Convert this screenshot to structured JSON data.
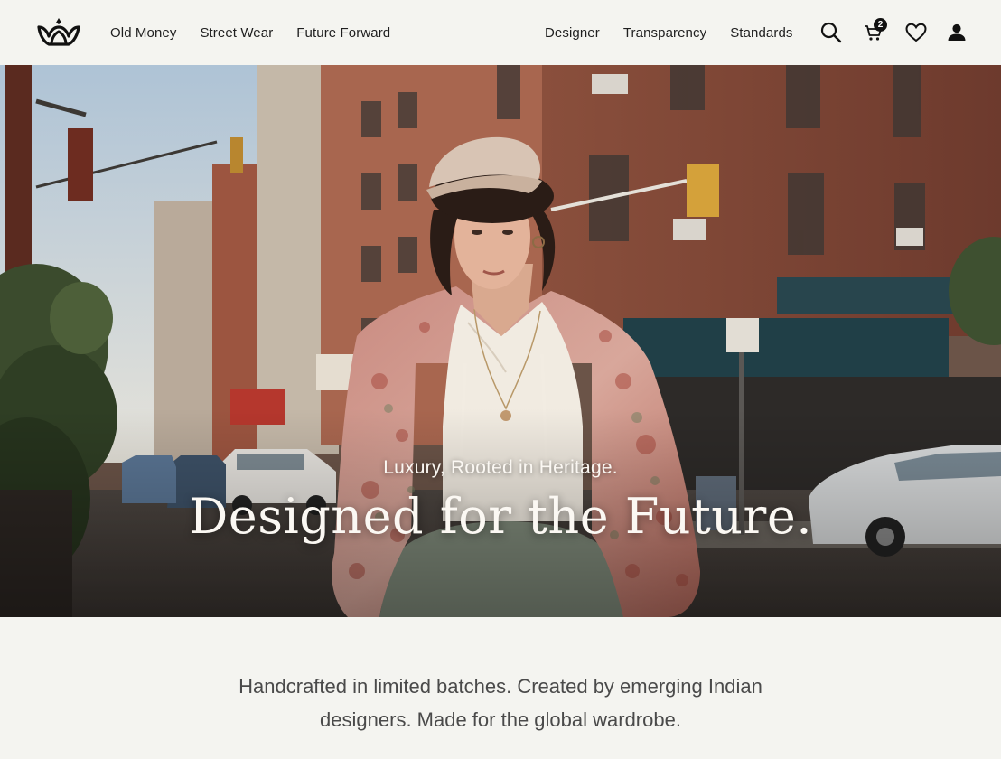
{
  "brand": {
    "logo_icon": "crown-lotus-icon"
  },
  "nav": {
    "left": [
      {
        "label": "Old Money"
      },
      {
        "label": "Street Wear"
      },
      {
        "label": "Future Forward"
      }
    ],
    "right": [
      {
        "label": "Designer"
      },
      {
        "label": "Transparency"
      },
      {
        "label": "Standards"
      }
    ]
  },
  "header_icons": {
    "search": "search-icon",
    "cart": "cart-icon",
    "cart_count": "2",
    "wishlist": "heart-icon",
    "account": "user-icon"
  },
  "hero": {
    "subtitle": "Luxury, Rooted in Heritage.",
    "title": "Designed for the Future."
  },
  "intro": {
    "text": "Handcrafted in limited batches. Created by emerging Indian designers. Made for the global wardrobe."
  },
  "colors": {
    "page_bg": "#f4f4f0",
    "text_dark": "#1b1b1b",
    "hero_text": "#fbf8f3",
    "intro_text": "#4a4a4a"
  }
}
